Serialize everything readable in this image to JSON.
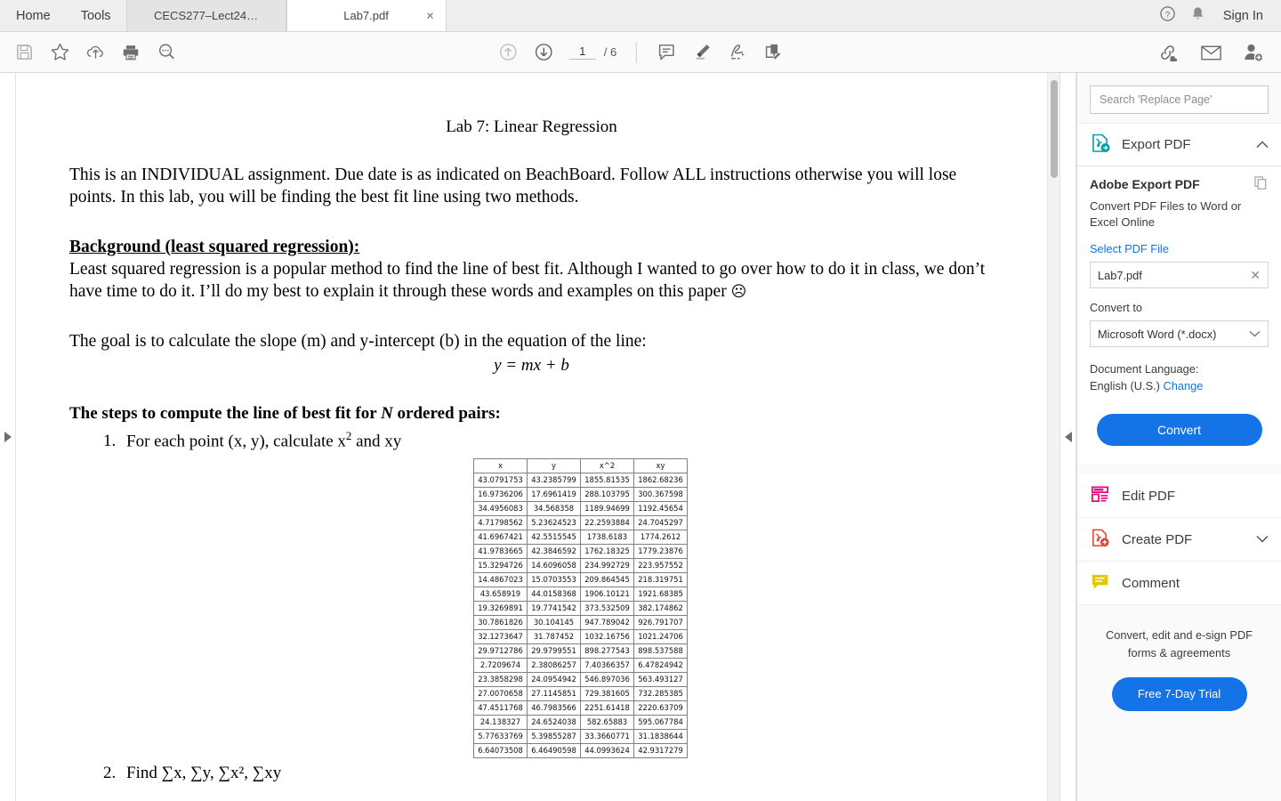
{
  "menu": {
    "home": "Home",
    "tools": "Tools"
  },
  "tabs": [
    {
      "label": "CECS277–Lect24…",
      "active": false,
      "closable": false
    },
    {
      "label": "Lab7.pdf",
      "active": true,
      "closable": true,
      "close": "×"
    }
  ],
  "header": {
    "sign_in": "Sign In",
    "help_icon": "help-icon",
    "bell_icon": "bell-icon"
  },
  "toolbar": {
    "left_icons": [
      "save-icon",
      "star-icon",
      "upload-cloud-icon",
      "print-icon",
      "zoom-search-icon"
    ],
    "page_current": "1",
    "page_total": "/ 6",
    "center_icons": [
      "scroll-up-icon",
      "scroll-down-icon",
      "comment-icon",
      "highlight-icon",
      "draw-icon",
      "sign-icon"
    ],
    "right_icons": [
      "share-link-icon",
      "email-icon",
      "add-person-icon"
    ]
  },
  "document": {
    "title": "Lab 7: Linear Regression",
    "intro": "This is an INDIVIDUAL assignment. Due date is as indicated on BeachBoard. Follow ALL instructions otherwise you will lose points. In this lab, you will be finding the best fit line using two methods.",
    "background_heading": "Background (least squared regression):",
    "background_body": "Least squared regression is a popular method to find the line of best fit. Although I wanted to go over how to do it in class, we don’t have time to do it. I’ll do my best to explain it through these words and examples on this paper",
    "background_emoji": "☹",
    "goal_text": "The goal is to calculate the slope (m) and y-intercept (b) in the equation of the line:",
    "equation": "y = mx + b",
    "steps_heading_pre": "The steps to compute the line of best fit for ",
    "steps_heading_var": "N",
    "steps_heading_post": " ordered pairs:",
    "step1_num": "1.",
    "step1_pre": "For each point (x, y), calculate x",
    "step1_sup": "2",
    "step1_post": " and xy",
    "step2_num": "2.",
    "step2_text": "Find ∑x, ∑y, ∑x², ∑xy",
    "table": {
      "headers": [
        "x",
        "y",
        "x^2",
        "xy"
      ],
      "rows": [
        [
          "43.0791753",
          "43.2385799",
          "1855.81535",
          "1862.68236"
        ],
        [
          "16.9736206",
          "17.6961419",
          "288.103795",
          "300.367598"
        ],
        [
          "34.4956083",
          "34.568358",
          "1189.94699",
          "1192.45654"
        ],
        [
          "4.71798562",
          "5.23624523",
          "22.2593884",
          "24.7045297"
        ],
        [
          "41.6967421",
          "42.5515545",
          "1738.6183",
          "1774.2612"
        ],
        [
          "41.9783665",
          "42.3846592",
          "1762.18325",
          "1779.23876"
        ],
        [
          "15.3294726",
          "14.6096058",
          "234.992729",
          "223.957552"
        ],
        [
          "14.4867023",
          "15.0703553",
          "209.864545",
          "218.319751"
        ],
        [
          "43.658919",
          "44.0158368",
          "1906.10121",
          "1921.68385"
        ],
        [
          "19.3269891",
          "19.7741542",
          "373.532509",
          "382.174862"
        ],
        [
          "30.7861826",
          "30.104145",
          "947.789042",
          "926.791707"
        ],
        [
          "32.1273647",
          "31.787452",
          "1032.16756",
          "1021.24706"
        ],
        [
          "29.9712786",
          "29.9799551",
          "898.277543",
          "898.537588"
        ],
        [
          "2.7209674",
          "2.38086257",
          "7.40366357",
          "6.47824942"
        ],
        [
          "23.3858298",
          "24.0954942",
          "546.897036",
          "563.493127"
        ],
        [
          "27.0070658",
          "27.1145851",
          "729.381605",
          "732.285385"
        ],
        [
          "47.4511768",
          "46.7983566",
          "2251.61418",
          "2220.63709"
        ],
        [
          "24.138327",
          "24.6524038",
          "582.65883",
          "595.067784"
        ],
        [
          "5.77633769",
          "5.39855287",
          "33.3660771",
          "31.1838644"
        ],
        [
          "6.64073508",
          "6.46490598",
          "44.0993624",
          "42.9317279"
        ]
      ]
    }
  },
  "right_panel": {
    "search_placeholder": "Search 'Replace Page'",
    "export_pdf_label": "Export PDF",
    "adobe_export_title": "Adobe Export PDF",
    "adobe_export_sub": "Convert PDF Files to Word or Excel Online",
    "select_file_link": "Select PDF File",
    "file_value": "Lab7.pdf",
    "file_clear": "✕",
    "convert_to_label": "Convert to",
    "convert_to_value": "Microsoft Word (*.docx)",
    "doc_language_label": "Document Language:",
    "doc_language_value": "English (U.S.)",
    "doc_language_change": "Change",
    "convert_button": "Convert",
    "tools": [
      {
        "label": "Edit PDF",
        "icon": "edit-pdf-icon",
        "chevron": false
      },
      {
        "label": "Create PDF",
        "icon": "create-pdf-icon",
        "chevron": true
      },
      {
        "label": "Comment",
        "icon": "comment-pdf-icon",
        "chevron": false
      }
    ],
    "promo_text": "Convert, edit and e-sign PDF forms & agreements",
    "promo_button": "Free 7-Day Trial"
  },
  "colors": {
    "accent_blue": "#1473e6",
    "export_teal": "#00a0a8",
    "edit_magenta": "#e6007e",
    "create_red": "#e8412f",
    "comment_yellow": "#e3c800"
  }
}
